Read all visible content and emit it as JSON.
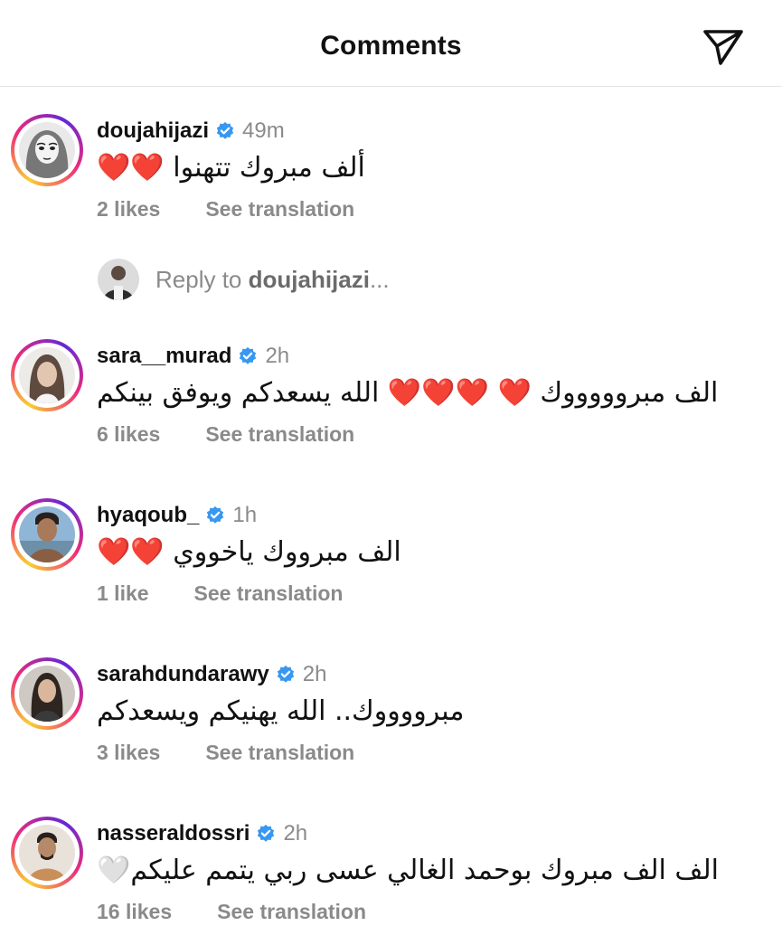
{
  "header": {
    "title": "Comments"
  },
  "reply_bar": {
    "prefix": "Reply to ",
    "username": "doujahijazi",
    "suffix": "..."
  },
  "colors": {
    "verified": "#3897f0",
    "muted": "#8a8a8a",
    "heart": "#e3132b"
  },
  "comments": [
    {
      "username": "doujahijazi",
      "time": "49m",
      "text": "ألف مبروك تتهنوا ❤️❤️",
      "likes": "2 likes",
      "translate": "See translation"
    },
    {
      "username": "sara__murad",
      "time": "2h",
      "text": "الف مبروووووك ❤️ ❤️❤️❤️ الله يسعدكم ويوفق بينكم",
      "likes": "6 likes",
      "translate": "See translation"
    },
    {
      "username": "hyaqoub_",
      "time": "1h",
      "text": "الف مبرووك ياخووي ❤️❤️",
      "likes": "1 like",
      "translate": "See translation"
    },
    {
      "username": "sarahdundarawy",
      "time": "2h",
      "text": "مبرووووك.. الله يهنيكم ويسعدكم",
      "likes": "3 likes",
      "translate": "See translation"
    },
    {
      "username": "nasseraldossri",
      "time": "2h",
      "text": "الف الف مبروك بوحمد الغالي عسى ربي يتمم عليكم🤍",
      "likes": "16 likes",
      "translate": "See translation"
    }
  ]
}
